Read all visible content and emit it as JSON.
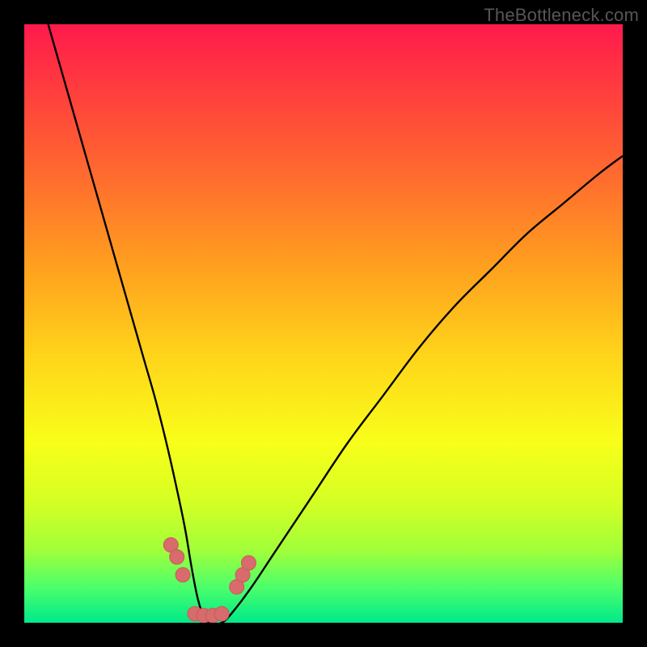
{
  "watermark": "TheBottleneck.com",
  "chart_data": {
    "type": "line",
    "title": "",
    "xlabel": "",
    "ylabel": "",
    "xlim": [
      0,
      100
    ],
    "ylim": [
      0,
      100
    ],
    "series": [
      {
        "name": "curve",
        "x": [
          4,
          6,
          8,
          10,
          12,
          14,
          16,
          18,
          20,
          22,
          24,
          26,
          27,
          28,
          29,
          30,
          31,
          33,
          35,
          38,
          42,
          48,
          54,
          60,
          66,
          72,
          78,
          84,
          90,
          96,
          100
        ],
        "y": [
          100,
          93,
          86,
          79,
          72,
          65,
          58,
          51,
          44,
          37,
          29,
          20,
          15,
          9,
          4,
          1,
          0,
          0,
          2,
          6,
          12,
          21,
          30,
          38,
          46,
          53,
          59,
          65,
          70,
          75,
          78
        ]
      }
    ],
    "markers": [
      {
        "x": 24.5,
        "y": 13
      },
      {
        "x": 25.5,
        "y": 11
      },
      {
        "x": 26.5,
        "y": 8
      },
      {
        "x": 28.5,
        "y": 1.5
      },
      {
        "x": 30.0,
        "y": 1.2
      },
      {
        "x": 31.5,
        "y": 1.2
      },
      {
        "x": 33.0,
        "y": 1.5
      },
      {
        "x": 35.5,
        "y": 6
      },
      {
        "x": 36.5,
        "y": 8
      },
      {
        "x": 37.5,
        "y": 10
      }
    ],
    "colors": {
      "curve": "#000000",
      "marker_fill": "#d86b6b",
      "marker_stroke": "#c95a5a"
    }
  }
}
